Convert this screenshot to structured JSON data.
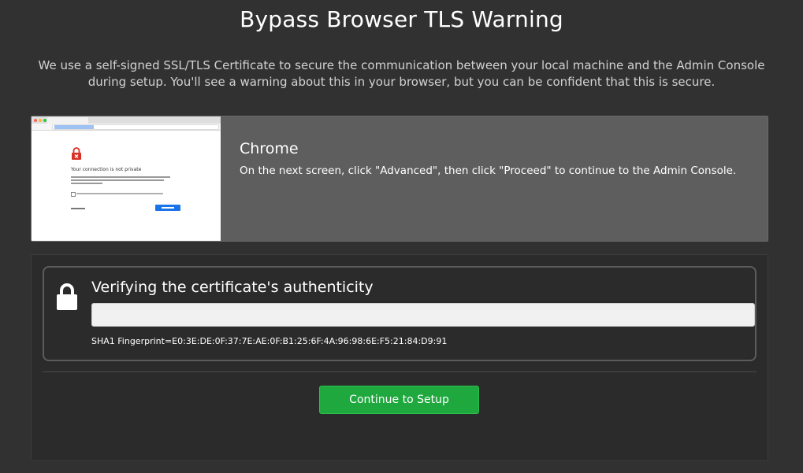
{
  "page": {
    "title": "Bypass Browser TLS Warning",
    "intro": "We use a self-signed SSL/TLS Certificate to secure the communication between your local machine and the Admin Console during setup. You'll see a warning about this in your browser, but you can be confident that this is secure."
  },
  "browser_hint": {
    "name": "Chrome",
    "instructions": "On the next screen, click \"Advanced\", then click \"Proceed\" to continue to the Admin Console.",
    "screenshot": {
      "heading": "Your connection is not private"
    }
  },
  "certificate": {
    "title": "Verifying the certificate's authenticity",
    "input_value": "",
    "fingerprint": "SHA1 Fingerprint=E0:3E:DE:0F:37:7E:AE:0F:B1:25:6F:4A:96:98:6E:F5:21:84:D9:91"
  },
  "actions": {
    "continue_label": "Continue to Setup"
  },
  "colors": {
    "background": "#313131",
    "panel": "#5e5e5e",
    "accent_green": "#1fa83e",
    "warning_red": "#d93025",
    "chrome_blue": "#1a73e8"
  },
  "icons": {
    "lock": "lock-icon",
    "warning_lock": "warning-lock-icon"
  }
}
